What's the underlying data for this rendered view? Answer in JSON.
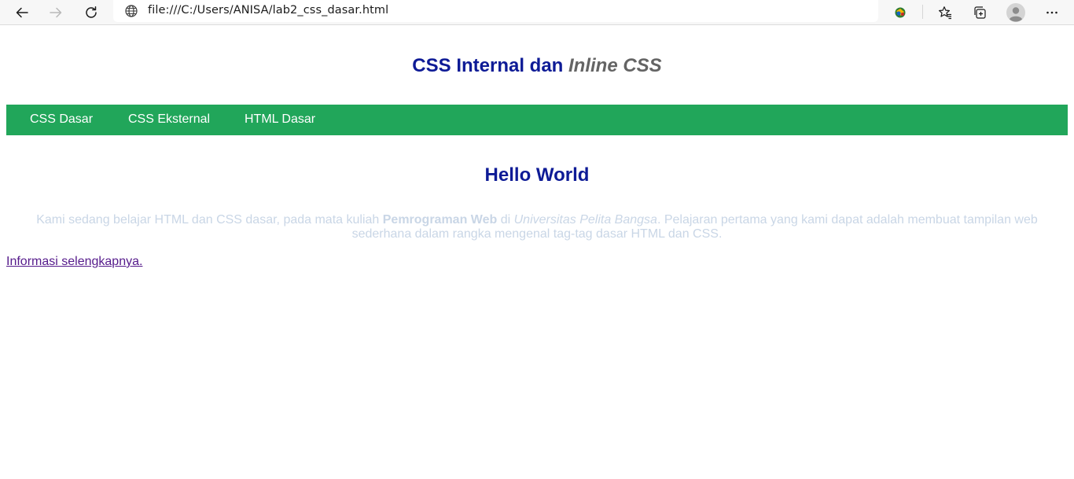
{
  "browser": {
    "url": "file:///C:/Users/ANISA/lab2_css_dasar.html",
    "icons": {
      "back": "back-arrow-icon",
      "forward": "forward-arrow-icon",
      "refresh": "refresh-icon",
      "site_info": "globe-icon",
      "extension": "extension-icon",
      "favorites": "favorites-star-icon",
      "collections": "collections-icon",
      "profile": "profile-avatar-icon",
      "menu": "more-menu-icon"
    }
  },
  "header": {
    "title_main": "CSS Internal dan ",
    "title_inline": "Inline CSS"
  },
  "nav": {
    "items": [
      {
        "label": "CSS Dasar"
      },
      {
        "label": "CSS Eksternal"
      },
      {
        "label": "HTML Dasar"
      }
    ]
  },
  "content": {
    "heading": "Hello World",
    "paragraph": {
      "part1": "Kami sedang belajar HTML dan CSS dasar, pada mata kuliah ",
      "bold": "Pemrograman Web",
      "part2": " di ",
      "italic": "Universitas Pelita Bangsa",
      "part3": ". Pelajaran pertama yang kami dapat adalah membuat tampilan web sederhana dalam rangka mengenal tag-tag dasar HTML dan CSS."
    },
    "link": "Informasi selengkapnya."
  },
  "colors": {
    "heading": "#0e1b96",
    "inline_title": "#646464",
    "navbar": "#21a65a",
    "paragraph": "#c9d6e6",
    "visited_link": "#551a8b"
  }
}
